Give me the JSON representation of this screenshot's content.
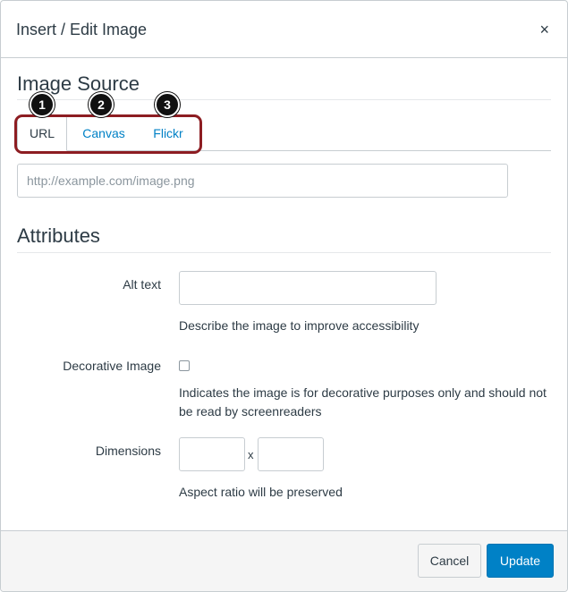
{
  "dialog": {
    "title": "Insert / Edit Image",
    "close_glyph": "×",
    "close_icon": "close-icon"
  },
  "image_source": {
    "heading": "Image Source",
    "tabs": [
      {
        "label": "URL",
        "active": true,
        "badge": "1"
      },
      {
        "label": "Canvas",
        "active": false,
        "badge": "2"
      },
      {
        "label": "Flickr",
        "active": false,
        "badge": "3"
      }
    ],
    "url_placeholder": "http://example.com/image.png",
    "url_value": ""
  },
  "attributes": {
    "heading": "Attributes",
    "alt_text_label": "Alt text",
    "alt_text_value": "",
    "alt_text_help": "Describe the image to improve accessibility",
    "decorative_label": "Decorative Image",
    "decorative_checked": false,
    "decorative_help": "Indicates the image is for decorative purposes only and should not be read by screenreaders",
    "dimensions_label": "Dimensions",
    "width_value": "",
    "height_value": "",
    "dimensions_separator": "x",
    "dimensions_help": "Aspect ratio will be preserved"
  },
  "footer": {
    "cancel_label": "Cancel",
    "update_label": "Update"
  },
  "colors": {
    "link": "#0081c6",
    "primary": "#0081c6",
    "highlight": "#8d1d22",
    "text": "#2d3b45"
  }
}
